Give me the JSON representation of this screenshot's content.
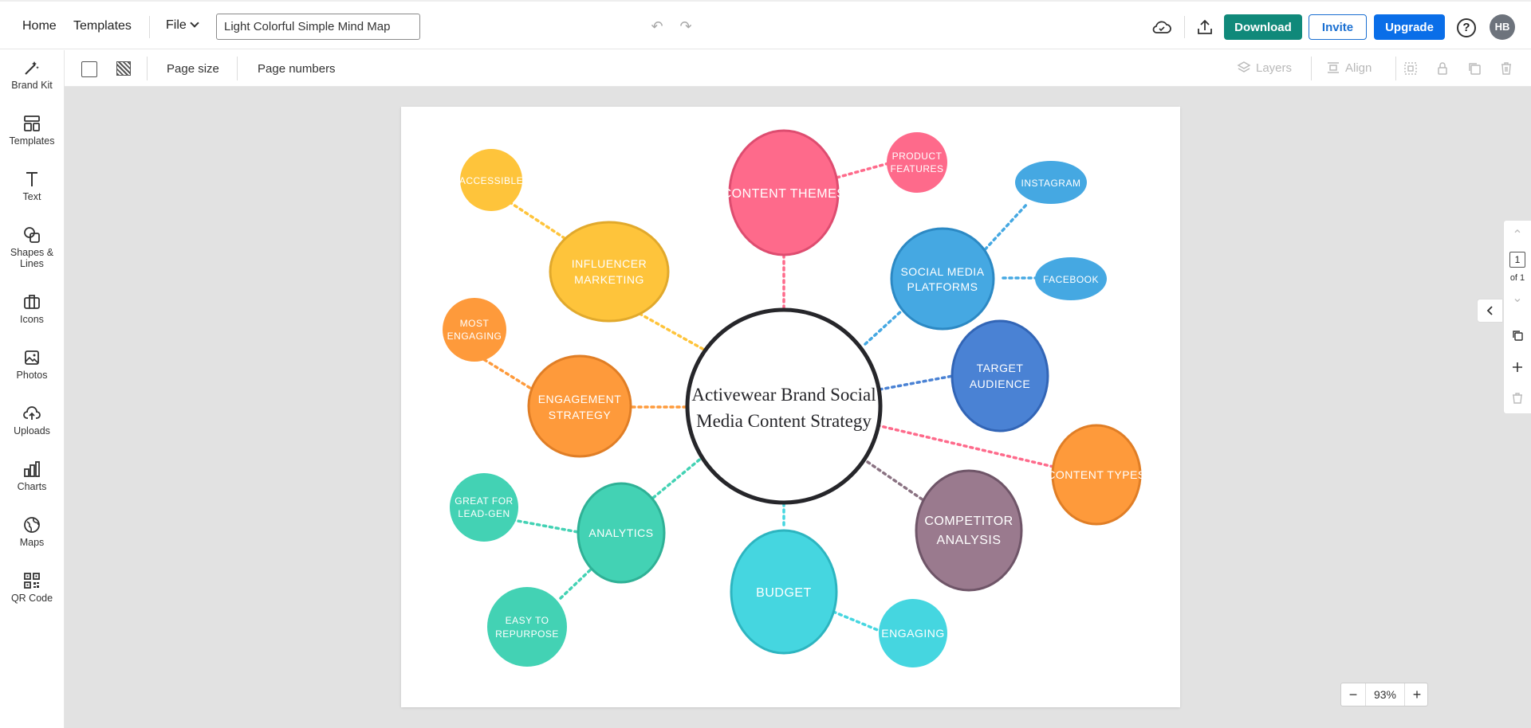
{
  "header": {
    "home": "Home",
    "templates": "Templates",
    "file": "File",
    "document_title": "Light Colorful Simple Mind Map",
    "download": "Download",
    "invite": "Invite",
    "upgrade": "Upgrade",
    "help": "?",
    "avatar_initials": "HB"
  },
  "toolbar": {
    "page_size": "Page size",
    "page_numbers": "Page numbers",
    "layers": "Layers",
    "align": "Align"
  },
  "sidebar": {
    "items": [
      {
        "label": "Brand Kit",
        "icon": "magic-wand-icon"
      },
      {
        "label": "Templates",
        "icon": "templates-icon"
      },
      {
        "label": "Text",
        "icon": "text-icon"
      },
      {
        "label": "Shapes & Lines",
        "icon": "shapes-icon"
      },
      {
        "label": "Icons",
        "icon": "briefcase-icon"
      },
      {
        "label": "Photos",
        "icon": "photo-icon"
      },
      {
        "label": "Uploads",
        "icon": "cloud-upload-icon"
      },
      {
        "label": "Charts",
        "icon": "chart-icon"
      },
      {
        "label": "Maps",
        "icon": "globe-icon"
      },
      {
        "label": "QR Code",
        "icon": "qr-code-icon"
      }
    ]
  },
  "mindmap": {
    "center": [
      "Activewear Brand Social",
      "Media Content Strategy"
    ],
    "nodes": {
      "accessible": [
        "ACCESSIBLE"
      ],
      "influencer": [
        "INFLUENCER",
        "MARKETING"
      ],
      "most_engaging": [
        "MOST",
        "ENGAGING"
      ],
      "engagement": [
        "ENGAGEMENT",
        "STRATEGY"
      ],
      "great_leadgen": [
        "GREAT FOR",
        "LEAD-GEN"
      ],
      "analytics": [
        "ANALYTICS"
      ],
      "easy_repurpose": [
        "EASY TO",
        "REPURPOSE"
      ],
      "content_themes": [
        "CONTENT THEMES"
      ],
      "product_features": [
        "PRODUCT",
        "FEATURES"
      ],
      "budget": [
        "BUDGET"
      ],
      "engaging": [
        "ENGAGING"
      ],
      "instagram": [
        "INSTAGRAM"
      ],
      "social_media": [
        "SOCIAL MEDIA",
        "PLATFORMS"
      ],
      "facebook": [
        "FACEBOOK"
      ],
      "target_audience": [
        "TARGET",
        "AUDIENCE"
      ],
      "content_types": [
        "CONTENT TYPES"
      ],
      "competitor": [
        "COMPETITOR",
        "ANALYSIS"
      ]
    },
    "colors": {
      "yellow": "#fec43b",
      "orange": "#fe9a3b",
      "teal": "#43d2b4",
      "pink": "#fe6a8b",
      "cyan": "#45d6e0",
      "blue": "#45a8e2",
      "indigo": "#4a82d4",
      "mauve": "#9a7a8e"
    }
  },
  "pagenav": {
    "current": "1",
    "of": "of 1"
  },
  "zoom": {
    "value": "93%",
    "minus": "−",
    "plus": "+"
  }
}
